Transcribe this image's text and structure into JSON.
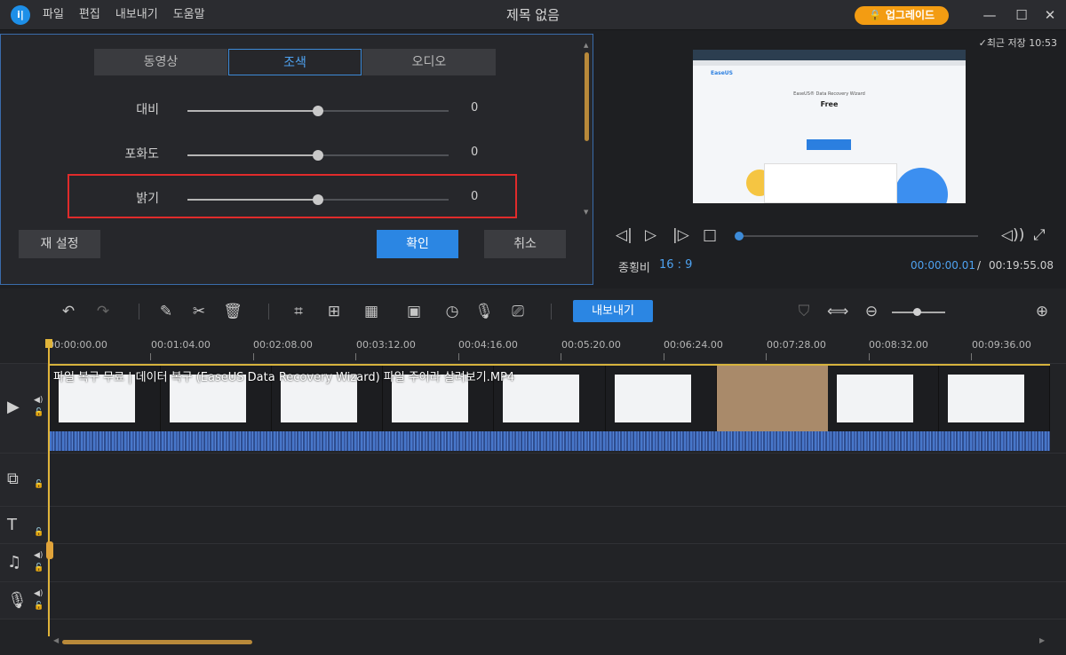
{
  "app": {
    "title": "제목 없음",
    "logo_text": "i|",
    "menu": [
      "파일",
      "편집",
      "내보내기",
      "도움말"
    ],
    "upgrade_label": "업그레이드",
    "window_controls": [
      "minimize-icon",
      "restore-icon",
      "maximize-icon",
      "close-icon"
    ]
  },
  "adjust_panel": {
    "tabs": [
      {
        "label": "동영상",
        "active": false
      },
      {
        "label": "조색",
        "active": true
      },
      {
        "label": "오디오",
        "active": false
      }
    ],
    "rows": [
      {
        "label": "대비",
        "value": "0",
        "level": 0.5
      },
      {
        "label": "포화도",
        "value": "0",
        "level": 0.5
      },
      {
        "label": "밝기",
        "value": "0",
        "level": 0.5
      }
    ],
    "reset_label": "재 설정",
    "confirm_label": "확인",
    "cancel_label": "취소"
  },
  "preview": {
    "save_note": "최근 저장 10:53",
    "aspect_label": "종횡비",
    "aspect_value": "16 : 9",
    "current_time": "00:00:00.01",
    "separator": "/",
    "total_time": "00:19:55.08",
    "frame_text": {
      "brand": "EaseUS",
      "headline": "EaseUS® Data Recovery Wizard",
      "free": "Free"
    }
  },
  "toolbar": {
    "export_label": "내보내기"
  },
  "timeline": {
    "ruler": [
      "00:00:00.00",
      "00:01:04.00",
      "00:02:08.00",
      "00:03:12.00",
      "00:04:16.00",
      "00:05:20.00",
      "00:06:24.00",
      "00:07:28.00",
      "00:08:32.00",
      "00:09:36.00"
    ],
    "clip_title": "파일 복구 무료 | 데이터 복구 (EaseUS Data Recovery Wizard) 파일 주어라 살려보기.MP4",
    "tracks": [
      "video",
      "overlay",
      "text",
      "music",
      "voice"
    ]
  },
  "colors": {
    "accent": "#2b86e3",
    "highlight": "#e02b2b",
    "upgrade": "#f39c12",
    "playhead": "#e0b43a"
  }
}
